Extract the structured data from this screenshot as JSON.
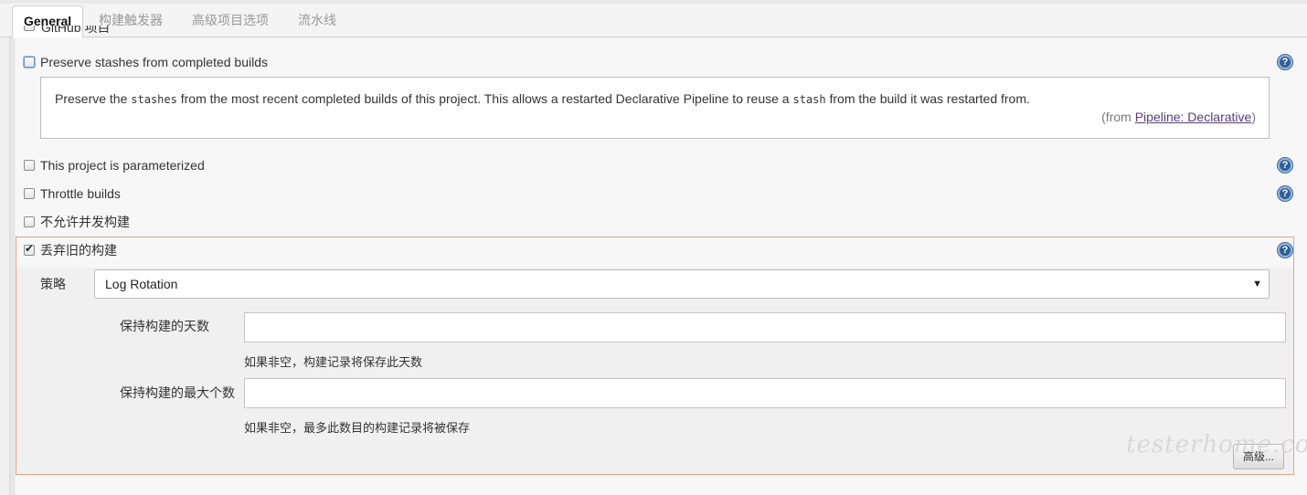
{
  "tabs": [
    {
      "label": "General"
    },
    {
      "label": "构建触发器"
    },
    {
      "label": "高级项目选项"
    },
    {
      "label": "流水线"
    }
  ],
  "partial_row": {
    "label": "GitHub 项目"
  },
  "options": {
    "preserve_stashes": {
      "label": "Preserve stashes from completed builds",
      "checked": false,
      "help": {
        "text_before": "Preserve the ",
        "code1": "stashes",
        "text_middle": " from the most recent completed builds of this project. This allows a restarted Declarative Pipeline to reuse a ",
        "code2": "stash",
        "text_after": " from the build it was restarted from.",
        "from_prefix": "(from ",
        "from_link": "Pipeline: Declarative",
        "from_suffix": ")"
      }
    },
    "parameterized": {
      "label": "This project is parameterized",
      "checked": false
    },
    "throttle": {
      "label": "Throttle builds",
      "checked": false
    },
    "no_concurrent": {
      "label": "不允许并发构建",
      "checked": false
    },
    "discard_old": {
      "label": "丢弃旧的构建",
      "checked": true,
      "tick": "✔"
    }
  },
  "discard_section": {
    "strategy_label": "策略",
    "strategy_value": "Log Rotation",
    "select_arrow": "▼",
    "days_label": "保持构建的天数",
    "days_value": "",
    "days_hint": "如果非空，构建记录将保存此天数",
    "max_label": "保持构建的最大个数",
    "max_value": "",
    "max_hint": "如果非空，最多此数目的构建记录将被保存",
    "advanced_button": "高级..."
  },
  "help_icon": {
    "glyph": "?",
    "name": "help-icon"
  },
  "watermark": "testerhome.com",
  "colors": {
    "section_border": "#e8a08a",
    "link": "#5a3b7a",
    "help_icon": "#2d5f9c"
  }
}
